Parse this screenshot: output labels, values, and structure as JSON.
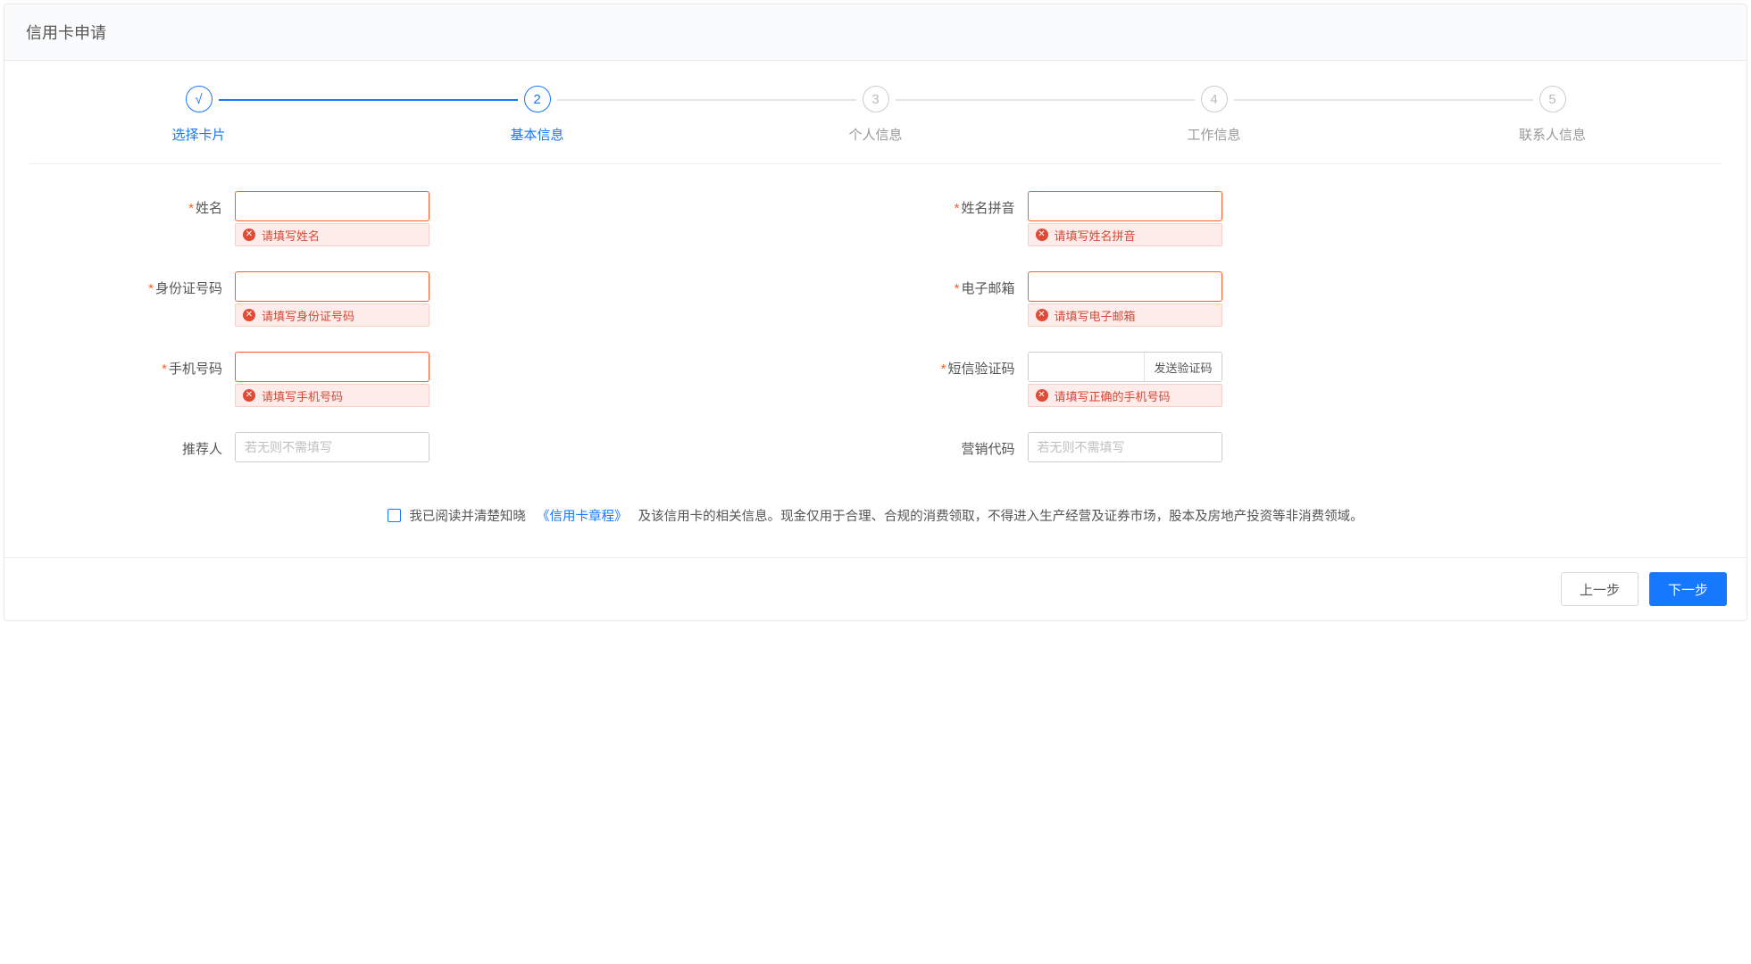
{
  "header": {
    "title": "信用卡申请"
  },
  "steps": [
    {
      "icon": "√",
      "label": "选择卡片",
      "state": "done"
    },
    {
      "icon": "2",
      "label": "基本信息",
      "state": "active"
    },
    {
      "icon": "3",
      "label": "个人信息",
      "state": "pending"
    },
    {
      "icon": "4",
      "label": "工作信息",
      "state": "pending"
    },
    {
      "icon": "5",
      "label": "联系人信息",
      "state": "pending"
    }
  ],
  "form": {
    "name": {
      "label": "姓名",
      "required": true,
      "value": "",
      "error": "请填写姓名"
    },
    "namePinyin": {
      "label": "姓名拼音",
      "required": true,
      "value": "",
      "error": "请填写姓名拼音"
    },
    "idNumber": {
      "label": "身份证号码",
      "required": true,
      "value": "",
      "error": "请填写身份证号码"
    },
    "email": {
      "label": "电子邮箱",
      "required": true,
      "value": "",
      "error": "请填写电子邮箱"
    },
    "phone": {
      "label": "手机号码",
      "required": true,
      "value": "",
      "error": "请填写手机号码"
    },
    "smsCode": {
      "label": "短信验证码",
      "required": true,
      "value": "",
      "error": "请填写正确的手机号码",
      "btn": "发送验证码"
    },
    "referrer": {
      "label": "推荐人",
      "required": false,
      "value": "",
      "placeholder": "若无则不需填写"
    },
    "marketCode": {
      "label": "营销代码",
      "required": false,
      "value": "",
      "placeholder": "若无则不需填写"
    }
  },
  "agreement": {
    "prefix": "我已阅读并清楚知晓",
    "link": "《信用卡章程》",
    "suffix": "及该信用卡的相关信息。现金仅用于合理、合规的消费领取，不得进入生产经营及证券市场，股本及房地产投资等非消费领域。"
  },
  "footer": {
    "prev": "上一步",
    "next": "下一步"
  }
}
